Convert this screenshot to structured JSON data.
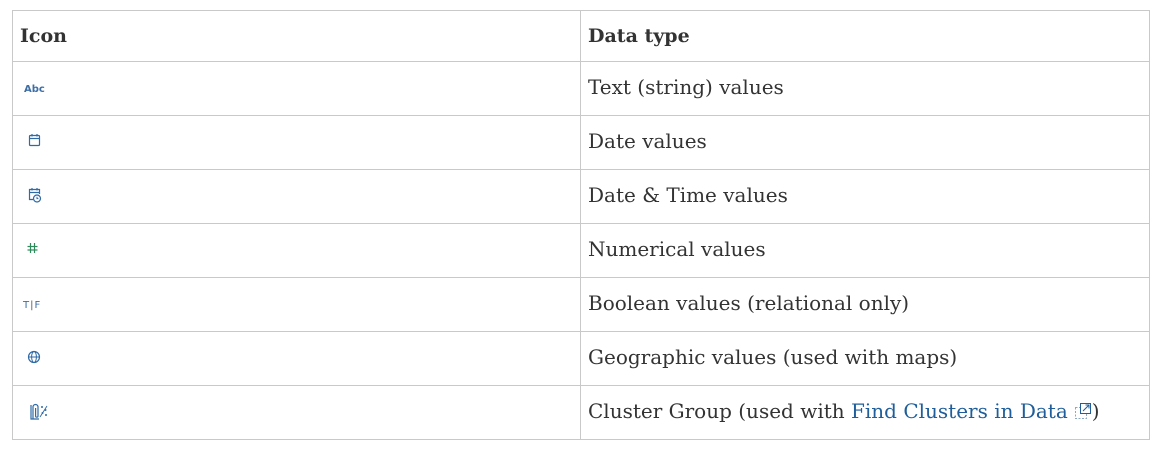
{
  "table": {
    "headers": {
      "icon": "Icon",
      "data_type": "Data type"
    },
    "rows": [
      {
        "icon_name": "abc-icon",
        "icon_text": "Abc",
        "label": "Text (string) values"
      },
      {
        "icon_name": "calendar-icon",
        "label": "Date values"
      },
      {
        "icon_name": "calendar-clock-icon",
        "label": "Date & Time values"
      },
      {
        "icon_name": "hash-icon",
        "label": "Numerical values"
      },
      {
        "icon_name": "true-false-icon",
        "icon_text_t": "T",
        "icon_text_f": "F",
        "label": "Boolean values (relational only)"
      },
      {
        "icon_name": "globe-icon",
        "label": "Geographic values (used with maps)"
      },
      {
        "icon_name": "cluster-group-icon",
        "label_prefix": "Cluster Group (used with ",
        "link_text": "Find Clusters in Data",
        "label_suffix": ")"
      }
    ]
  },
  "colors": {
    "icon": "#2f6aa6",
    "link": "#1f5e9a",
    "border": "#c9c9c9",
    "text": "#333333"
  }
}
